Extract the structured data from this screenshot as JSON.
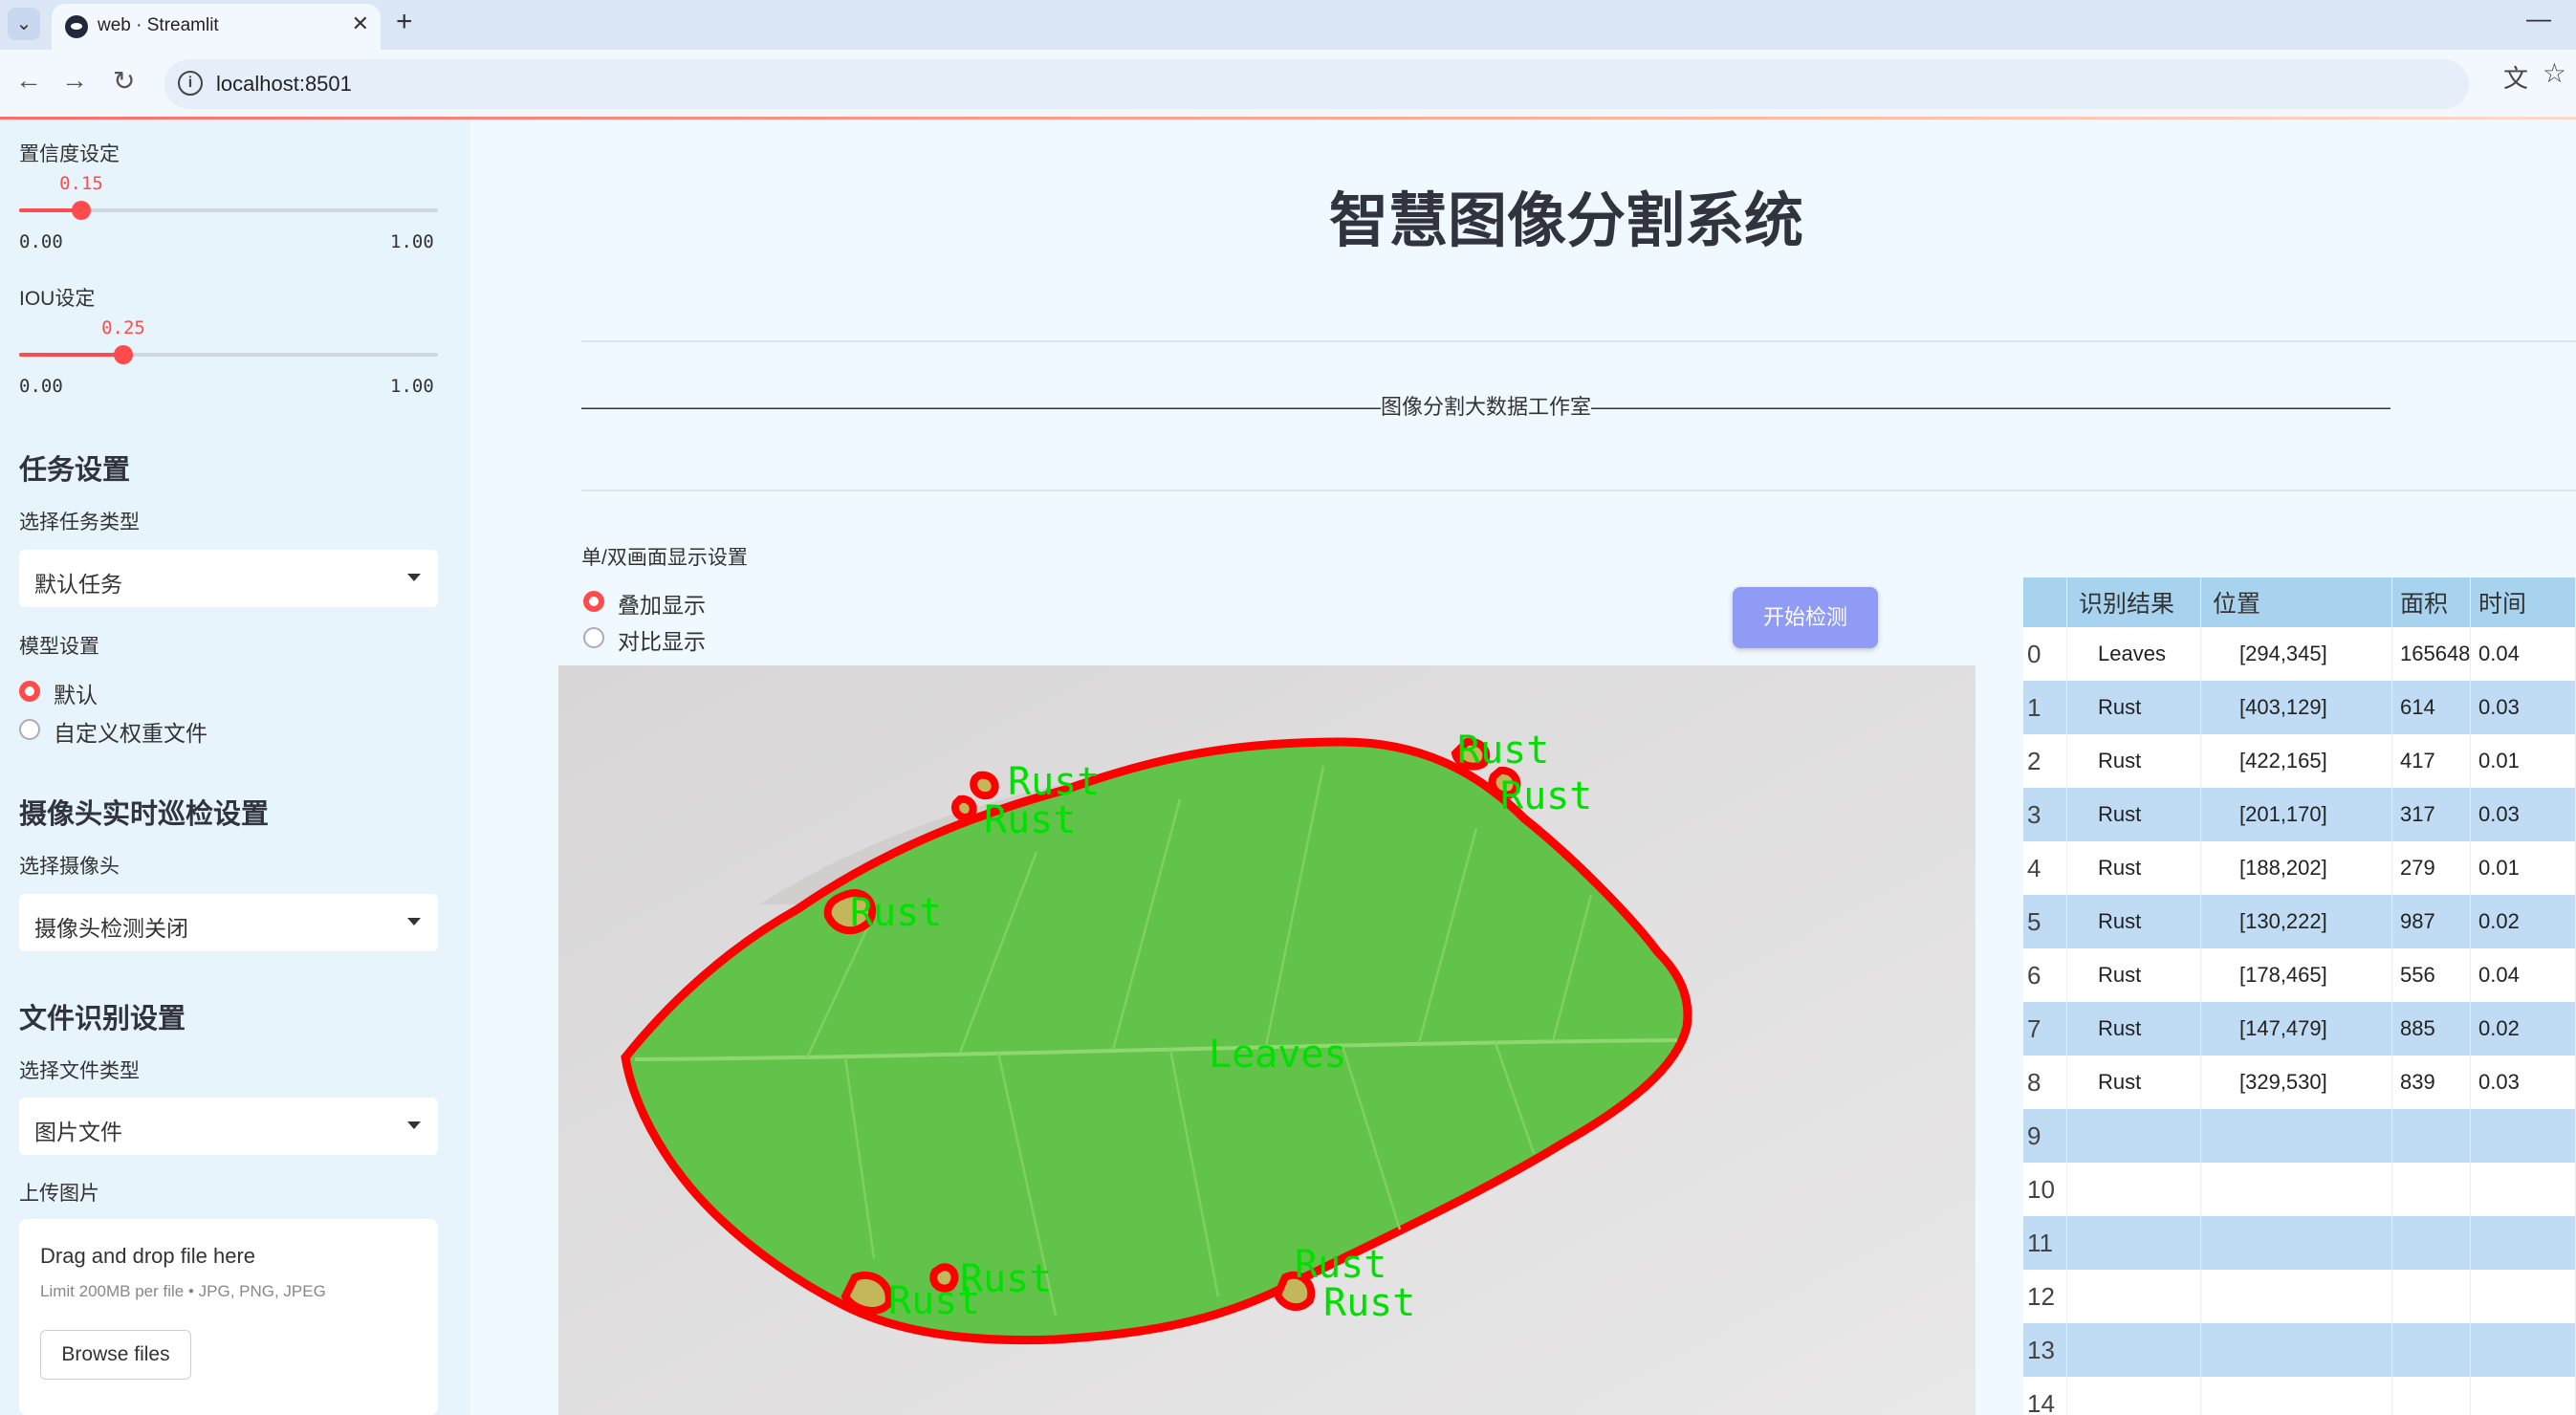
{
  "browser": {
    "tab_title": "web · Streamlit",
    "url": "localhost:8501"
  },
  "sidebar": {
    "confidence": {
      "label": "置信度设定",
      "value": 0.15,
      "value_text": "0.15",
      "min": "0.00",
      "max": "1.00"
    },
    "iou": {
      "label": "IOU设定",
      "value": 0.25,
      "value_text": "0.25",
      "min": "0.00",
      "max": "1.00"
    },
    "task_heading": "任务设置",
    "task_type_label": "选择任务类型",
    "task_type_value": "默认任务",
    "model_label": "模型设置",
    "model_options": [
      "默认",
      "自定义权重文件"
    ],
    "camera_heading": "摄像头实时巡检设置",
    "camera_label": "选择摄像头",
    "camera_value": "摄像头检测关闭",
    "file_heading": "文件识别设置",
    "file_type_label": "选择文件类型",
    "file_type_value": "图片文件",
    "upload_label": "上传图片",
    "upload_title": "Drag and drop file here",
    "upload_hint": "Limit 200MB per file • JPG, PNG, JPEG",
    "browse_label": "Browse files"
  },
  "main": {
    "title": "智慧图像分割系统",
    "studio_line": "——————————————————————————————————————图像分割大数据工作室——————————————————————————————————————",
    "display_label": "单/双画面显示设置",
    "display_options": [
      "叠加显示",
      "对比显示"
    ],
    "start_button": "开始检测"
  },
  "image": {
    "labels": [
      "Rust",
      "Rust",
      "Rust",
      "Rust",
      "Rust",
      "Rust",
      "Leaves",
      "Rust",
      "Rust",
      "Rust"
    ]
  },
  "table": {
    "headers": [
      "",
      "识别结果",
      "位置",
      "面积",
      "时间"
    ],
    "rows": [
      [
        "0",
        "Leaves",
        "[294,345]",
        "165648",
        "0.04"
      ],
      [
        "1",
        "Rust",
        "[403,129]",
        "614",
        "0.03"
      ],
      [
        "2",
        "Rust",
        "[422,165]",
        "417",
        "0.01"
      ],
      [
        "3",
        "Rust",
        "[201,170]",
        "317",
        "0.03"
      ],
      [
        "4",
        "Rust",
        "[188,202]",
        "279",
        "0.01"
      ],
      [
        "5",
        "Rust",
        "[130,222]",
        "987",
        "0.02"
      ],
      [
        "6",
        "Rust",
        "[178,465]",
        "556",
        "0.04"
      ],
      [
        "7",
        "Rust",
        "[147,479]",
        "885",
        "0.02"
      ],
      [
        "8",
        "Rust",
        "[329,530]",
        "839",
        "0.03"
      ],
      [
        "9",
        "",
        "",
        "",
        ""
      ],
      [
        "10",
        "",
        "",
        "",
        ""
      ],
      [
        "11",
        "",
        "",
        "",
        ""
      ],
      [
        "12",
        "",
        "",
        "",
        ""
      ],
      [
        "13",
        "",
        "",
        "",
        ""
      ],
      [
        "14",
        "",
        "",
        "",
        ""
      ]
    ]
  },
  "colors": {
    "accent": "#ff4b4b",
    "button": "#8f9bf5",
    "mask_outline": "#ff0000",
    "label_text": "#00ff00"
  }
}
